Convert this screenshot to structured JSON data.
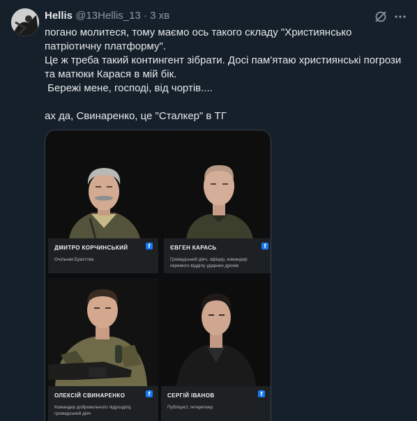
{
  "author": {
    "name": "Hellis",
    "handle": "@13Hellis_13",
    "time": "3 хв"
  },
  "icons": {
    "grok": "grok-icon",
    "more": "more-icon"
  },
  "tweet": {
    "lines": [
      "погано молитеся, тому маємо ось такого складу \"Християнсько",
      "патріотичну платформу\".",
      "Це ж треба такий контингент зібрати. Досі пам'ятаю християнські погрози",
      "та матюки Карася в мій бік.",
      " Бережі мене, господі, від чортів....",
      "",
      "ах да, Свинаренко, це \"Сталкер\" в ТГ"
    ]
  },
  "cards": [
    {
      "name": "ДМИТРО КОРЧИНСЬКИЙ",
      "role": "Очільник Братства"
    },
    {
      "name": "ЄВГЕН КАРАСЬ",
      "role": "Громадський діяч, офіцер, командир окремого відділу ударних дронів"
    },
    {
      "name": "ОЛЕКСІЙ СВИНАРЕНКО",
      "role": "Командир добровольчого підрозділу, громадський діяч"
    },
    {
      "name": "СЕРГІЙ ІВАНОВ",
      "role": "Публіцист, інтерв'юер"
    }
  ],
  "colors": {
    "background": "#15202b",
    "secondary_text": "#8b98a5",
    "facebook": "#1877f2"
  }
}
